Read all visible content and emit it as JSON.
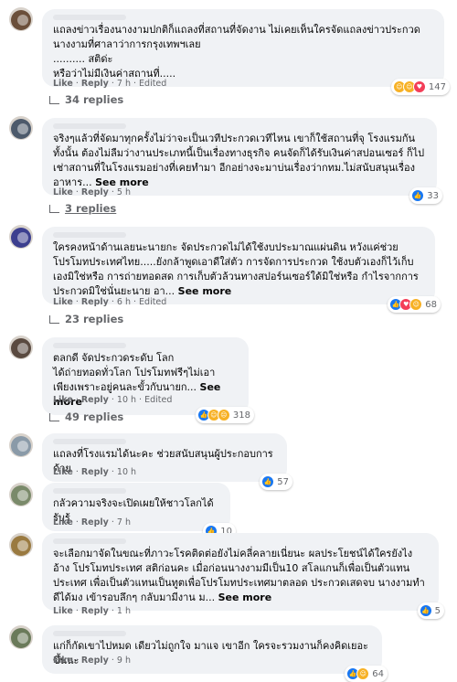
{
  "colors": {
    "like": "#1877f2",
    "haha": "#f7b125",
    "love": "#f33e58",
    "muted": "#65676b",
    "bubble": "#f0f2f5"
  },
  "comments": [
    {
      "text": "แถลงข่าวเรื่องนางงามปกติก็แถลงที่สถานที่จัดงาน ไม่เคยเห็นใครจัดแถลงข่าวประกวด\nนางงามที่ศาลาว่าการกรุงเทพฯเลย\n.......... สติด่ะ\nหรือว่าไม่มีเงินค่าสถานที่.....",
      "see_more": "",
      "like": "Like",
      "reply": "Reply",
      "time": "7 h",
      "edited": "Edited",
      "reaction_icons": [
        "haha-icon",
        "haha-icon",
        "love-icon"
      ],
      "reactions": "147",
      "replies": "34 replies",
      "avatar_color": "#6b4f3a"
    },
    {
      "text": "จริงๆแล้วที่จัดมาทุกครั้งไม่ว่าจะเป็นเวทีประกวดเวทีไหน เขาก็ใช้สถานที่จุ โรงแรมกันทั้งนั้น ต้องไม่ลืมว่างานประเภทนี้เป็นเรื่องทางธุรกิจ คนจัดก็ได้รับเงินค่าสปอนเซอร์ ก็ไปเช่าสถานที่ในโรงแรมอย่างที่เคยทำมา อีกอย่างจะมาบ่นเรื่องว่ากทม.ไม่สนับสนุนเรื่องอาหาร...",
      "see_more": "See more",
      "like": "Like",
      "reply": "Reply",
      "time": "5 h",
      "edited": "",
      "reaction_icons": [
        "like-icon"
      ],
      "reactions": "33",
      "replies": "3 replies",
      "avatar_color": "#4d5a6b"
    },
    {
      "text": "ใครคงหน้าด้านเลยนะนายกะ จัดประกวดไม่ได้ใช้งบประมาณแผ่นดิน หวังแค่ช่วย โปรโมทประเทศไทย.....ยังกล้าพูดเอาดีใส่ตัว การจัดการประกวด ใช้งบตัวเองก็ไว้เก็บเองมิใช่หรือ การถ่ายทอดสด การเก็บตัวล้วนทางสปอร์นเซอร์ใด้มิใช่หรือ กำไรจากการประกวดมิใช่นั่นยะนาย อา...",
      "see_more": "See more",
      "like": "Like",
      "reply": "Reply",
      "time": "6 h",
      "edited": "Edited",
      "reaction_icons": [
        "like-icon",
        "love-icon",
        "haha-icon"
      ],
      "reactions": "68",
      "replies": "23 replies",
      "avatar_color": "#3c3f8f"
    },
    {
      "text": "ตลกดี จัดประกวดระดับ โลก\nได้ถ่ายทอดทั่วโลก โปรโมทฟรีๆไม่เอา\nเพียงเพราะอยู่คนละขั้วกับนายก...",
      "see_more": "See more",
      "like": "Like",
      "reply": "Reply",
      "time": "10 h",
      "edited": "Edited",
      "reaction_icons": [
        "like-icon",
        "haha-icon",
        "sad-icon"
      ],
      "reactions": "318",
      "replies": "49 replies",
      "avatar_color": "#5a4a40"
    },
    {
      "text": "แถลงที่โรงแรมได้นะคะ ช่วยสนับสนุนผู้ประกอบการด้วย",
      "see_more": "",
      "like": "Like",
      "reply": "Reply",
      "time": "10 h",
      "edited": "",
      "reaction_icons": [
        "like-icon"
      ],
      "reactions": "57",
      "replies": "",
      "avatar_color": "#8a9aa8"
    },
    {
      "text": "กลัวความจริงจะเปิดเผยให้ชาวโลกได้รับรู้",
      "see_more": "",
      "like": "Like",
      "reply": "Reply",
      "time": "7 h",
      "edited": "",
      "reaction_icons": [
        "like-icon"
      ],
      "reactions": "10",
      "replies": "",
      "avatar_color": "#7a8a6a"
    },
    {
      "text": "จะเลือกมาจัดในขณะที่ภาวะโรคติดต่อยังไม่คลี่คลายเนี่ยนะ ผลประโยชน์ได้ใครยังไง อ้าง โปรโมทประเทศ สติก่อนคะ เมื่อก่อนนางงามมีเป็น10 สโลแกนก็เพื่อเป็นตัวแทนประเทศ เพื่อเป็นตัวแทนเป็นทูตเพื่อโปรโมทประเทศมาตลอด ประกวดเสดจบ นางงามทำดีได้มง เข้ารอบลึกๆ กลับมามีงาน ม...",
      "see_more": "See more",
      "like": "Like",
      "reply": "Reply",
      "time": "1 h",
      "edited": "",
      "reaction_icons": [
        "like-icon"
      ],
      "reactions": "5",
      "replies": "",
      "avatar_color": "#9a7a40"
    },
    {
      "text": "แก่ก็กัดเขาไปหมด เดียวไม่ถูกใจ มาแจ เขาอีก ใครจะรวมงานก็คงคิดเยอะขึ้นนะ",
      "see_more": "",
      "like": "Like",
      "reply": "Reply",
      "time": "9 h",
      "edited": "",
      "reaction_icons": [
        "like-icon",
        "haha-icon"
      ],
      "reactions": "64",
      "replies": "",
      "avatar_color": "#6a7a5a"
    }
  ]
}
